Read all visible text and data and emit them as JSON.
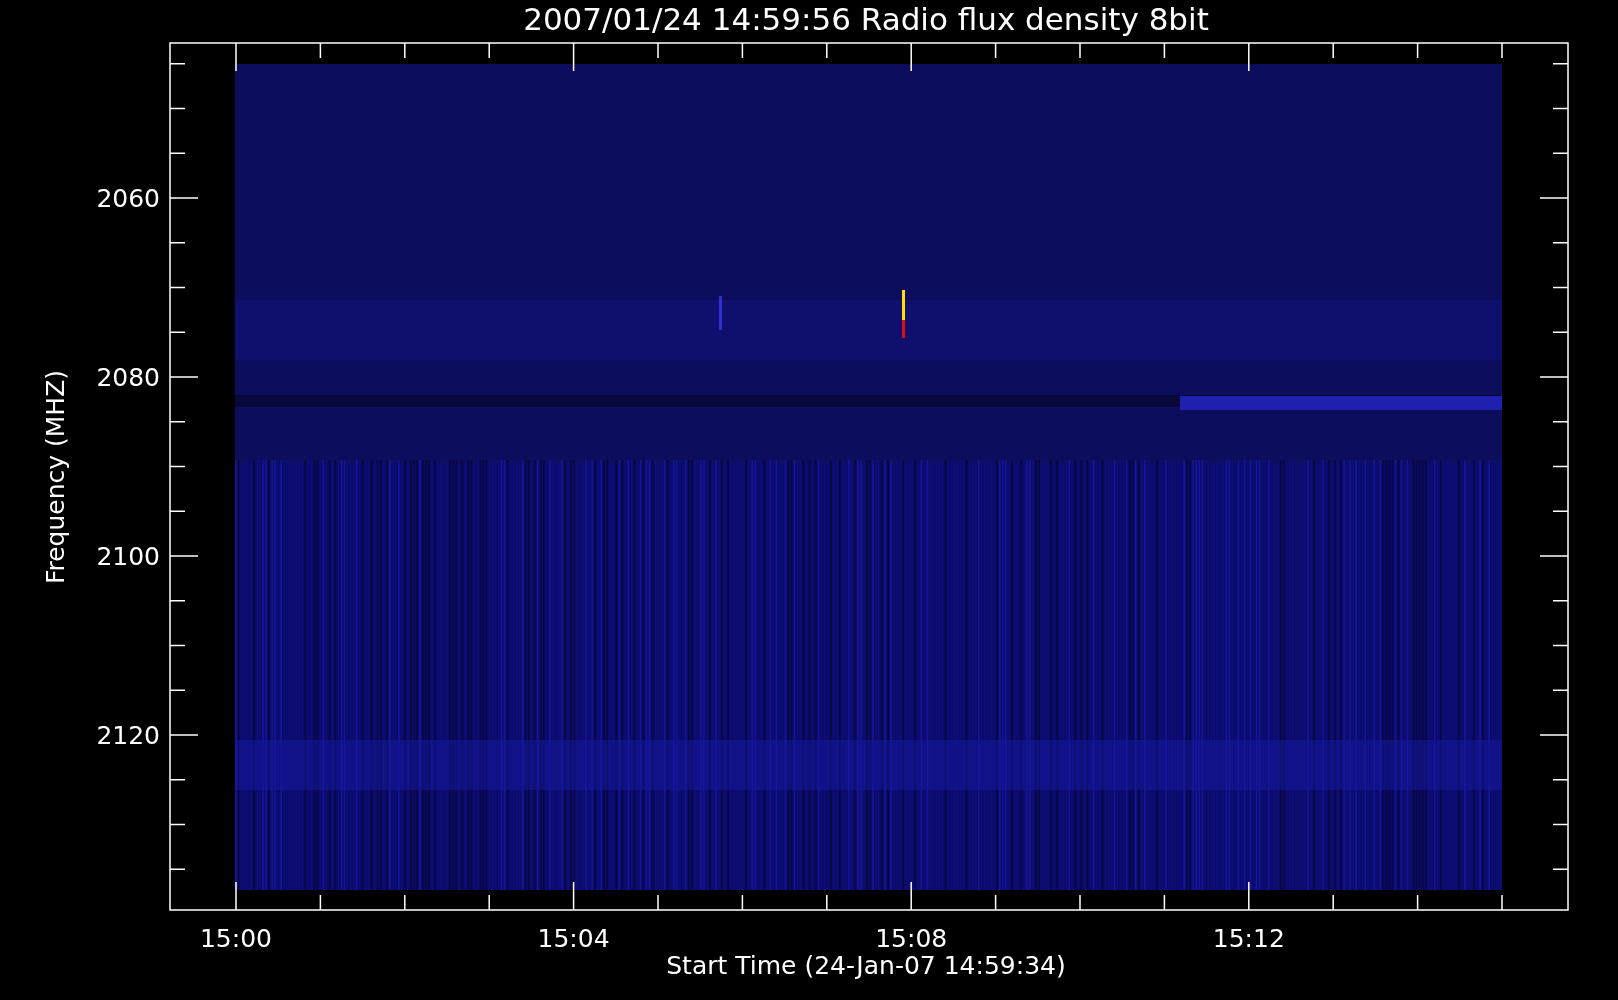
{
  "title": "2007/01/24 14:59:56 Radio flux density 8bit",
  "y_axis": {
    "label": "Frequency (MHZ)",
    "ticks": [
      "2060",
      "2080",
      "2100",
      "2120"
    ]
  },
  "x_axis": {
    "label": "Start Time (24-Jan-07 14:59:34)",
    "ticks": [
      "15:00",
      "15:04",
      "15:08",
      "15:12"
    ]
  }
}
